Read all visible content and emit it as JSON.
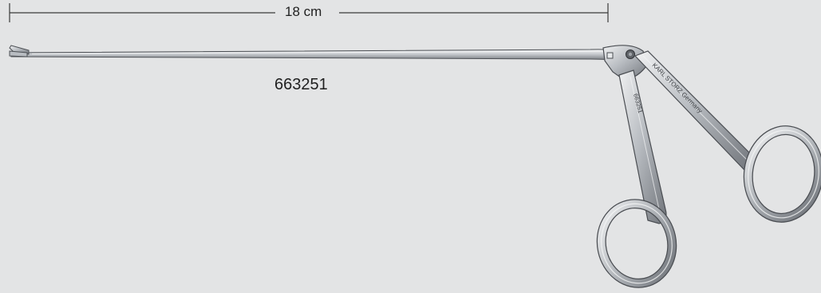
{
  "dimension": {
    "length_label": "18 cm"
  },
  "product": {
    "model_number": "663251",
    "brand_engraving": "KARL STORZ Germany",
    "shank_engraving": "663251"
  },
  "colors": {
    "background": "#e3e4e5",
    "steel_light": "#d8dadc",
    "steel_mid": "#a7abb0",
    "steel_dark": "#4a4d52",
    "text": "#1f1f1f"
  }
}
